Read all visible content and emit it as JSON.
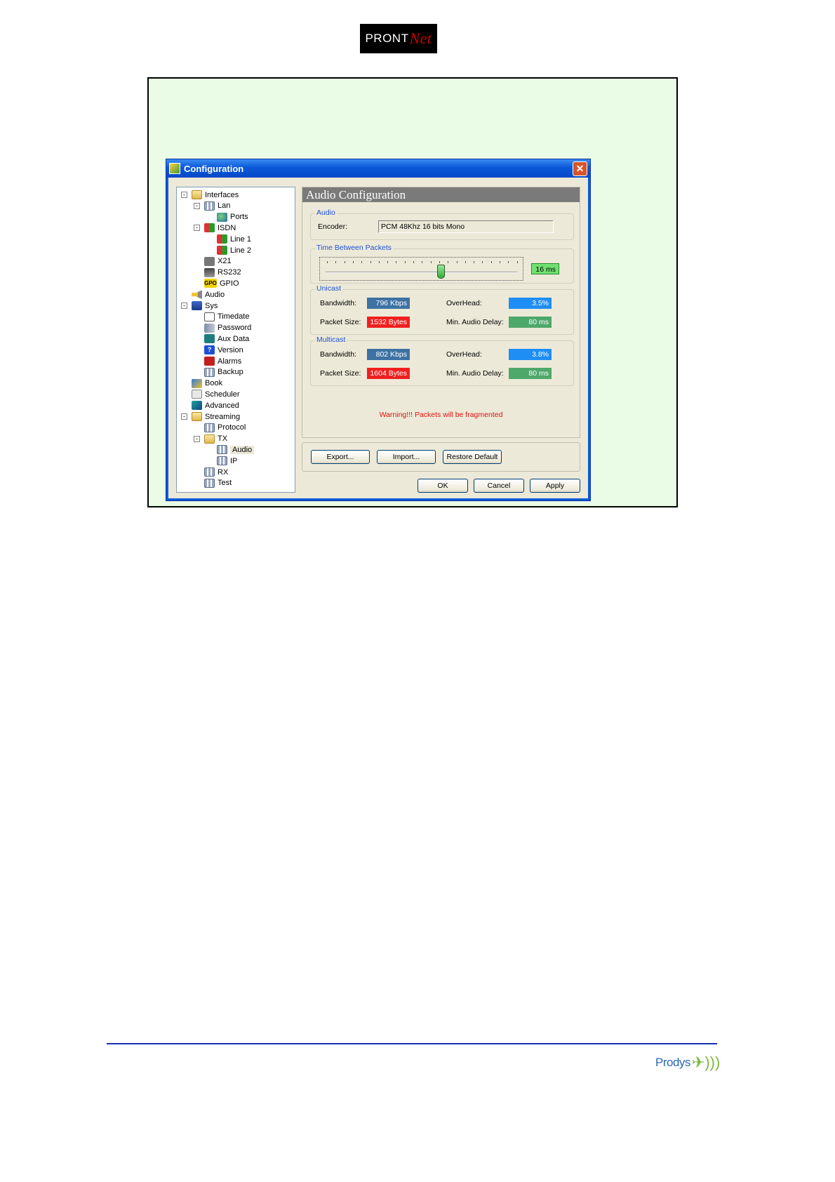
{
  "brand_top": {
    "text": "PRONT",
    "swoosh": "Net"
  },
  "window": {
    "title": "Configuration"
  },
  "tree": [
    {
      "label": "Interfaces",
      "icon": "folder-icon",
      "level": 0,
      "expander": "-"
    },
    {
      "label": "Lan",
      "icon": "network-icon",
      "level": 1,
      "expander": "-"
    },
    {
      "label": "Ports",
      "icon": "globe-icon",
      "level": 2
    },
    {
      "label": "ISDN",
      "icon": "isdn-icon",
      "level": 1,
      "expander": "-"
    },
    {
      "label": "Line 1",
      "icon": "isdn-icon",
      "level": 2
    },
    {
      "label": "Line 2",
      "icon": "isdn-icon",
      "level": 2
    },
    {
      "label": "X21",
      "icon": "x21-icon",
      "level": 1
    },
    {
      "label": "RS232",
      "icon": "rs232-icon",
      "level": 1
    },
    {
      "label": "GPIO",
      "icon": "gpio-icon",
      "level": 1
    },
    {
      "label": "Audio",
      "icon": "speaker-icon",
      "level": 0
    },
    {
      "label": "Sys",
      "icon": "computer-icon",
      "level": 0,
      "expander": "-"
    },
    {
      "label": "Timedate",
      "icon": "clock-icon",
      "level": 1
    },
    {
      "label": "Password",
      "icon": "key-icon",
      "level": 1
    },
    {
      "label": "Aux Data",
      "icon": "aux-icon",
      "level": 1
    },
    {
      "label": "Version",
      "icon": "help-icon",
      "level": 1
    },
    {
      "label": "Alarms",
      "icon": "alarm-icon",
      "level": 1
    },
    {
      "label": "Backup",
      "icon": "network-icon",
      "level": 1
    },
    {
      "label": "Book",
      "icon": "book-icon",
      "level": 0
    },
    {
      "label": "Scheduler",
      "icon": "scheduler-icon",
      "level": 0
    },
    {
      "label": "Advanced",
      "icon": "advanced-icon",
      "level": 0
    },
    {
      "label": "Streaming",
      "icon": "folder-icon",
      "level": 0,
      "expander": "-"
    },
    {
      "label": "Protocol",
      "icon": "network-icon",
      "level": 1
    },
    {
      "label": "TX",
      "icon": "folder-icon",
      "level": 1,
      "expander": "-"
    },
    {
      "label": "Audio",
      "icon": "network-icon",
      "level": 2,
      "selected": true
    },
    {
      "label": "IP",
      "icon": "network-icon",
      "level": 2
    },
    {
      "label": "RX",
      "icon": "network-icon",
      "level": 1
    },
    {
      "label": "Test",
      "icon": "network-icon",
      "level": 1
    }
  ],
  "panel": {
    "title": "Audio Configuration",
    "audio": {
      "legend": "Audio",
      "encoder_label": "Encoder:",
      "encoder_value": "PCM 48Khz 16 bits Mono"
    },
    "tbp": {
      "legend": "Time Between Packets",
      "value": "16 ms",
      "slider_fraction": 0.6
    },
    "unicast": {
      "legend": "Unicast",
      "bandwidth_label": "Bandwidth:",
      "bandwidth_value": "796 Kbps",
      "overhead_label": "OverHead:",
      "overhead_value": "3.5%",
      "packet_label": "Packet Size:",
      "packet_value": "1532 Bytes",
      "delay_label": "Min. Audio Delay:",
      "delay_value": "80 ms"
    },
    "multicast": {
      "legend": "Multicast",
      "bandwidth_label": "Bandwidth:",
      "bandwidth_value": "802 Kbps",
      "overhead_label": "OverHead:",
      "overhead_value": "3.8%",
      "packet_label": "Packet Size:",
      "packet_value": "1604 Bytes",
      "delay_label": "Min. Audio Delay:",
      "delay_value": "80 ms"
    },
    "warning": "Warning!!! Packets will be fragmented"
  },
  "buttons": {
    "export": "Export...",
    "import": "Import...",
    "restore": "Restore Default",
    "ok": "OK",
    "cancel": "Cancel",
    "apply": "Apply"
  },
  "brand_bottom": {
    "text": "Prodys"
  },
  "colors": {
    "frame_bg": "#eafbe6",
    "titlebar": "#0a58d8",
    "legend": "#1e53d8",
    "warning": "#e01010"
  }
}
